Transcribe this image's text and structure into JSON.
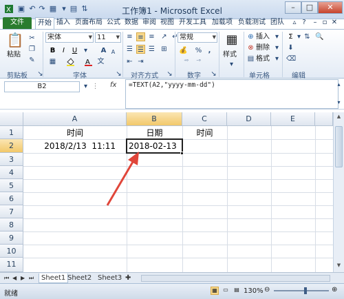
{
  "window": {
    "title": "工作簿1 - Microsoft Excel"
  },
  "tabs": [
    "文件",
    "开始",
    "插入",
    "页面布局",
    "公式",
    "数据",
    "审阅",
    "视图",
    "开发工具",
    "加载项",
    "负载测试",
    "团队"
  ],
  "ribbon": {
    "clipboard": {
      "paste": "粘贴",
      "label": "剪贴板"
    },
    "font": {
      "name": "宋体",
      "size": "11",
      "label": "字体",
      "bold": "B",
      "italic": "I",
      "underline": "U",
      "grow": "A",
      "shrink": "A",
      "wen": "文"
    },
    "alignment": {
      "label": "对齐方式"
    },
    "number": {
      "format": "常规",
      "percent": "%",
      "comma": ",",
      "label": "数字"
    },
    "styles": {
      "label": "样式"
    },
    "cells": {
      "insert": "插入",
      "delete": "删除",
      "format": "格式",
      "label": "单元格"
    },
    "editing": {
      "sigma": "Σ",
      "label": "编辑"
    }
  },
  "formula_bar": {
    "name_box": "B2",
    "fx": "fx",
    "formula": "=TEXT(A2,\"yyyy-mm-dd\")"
  },
  "sheet": {
    "columns": [
      "A",
      "B",
      "C",
      "D",
      "E"
    ],
    "rows": [
      "1",
      "2",
      "3",
      "4",
      "5",
      "6",
      "7",
      "8",
      "9",
      "10",
      "11"
    ],
    "cells": {
      "A1": "时间",
      "B1": "日期",
      "C1": "时间",
      "A2": "2018/2/13  11:11",
      "B2": "2018-02-13"
    }
  },
  "sheet_tabs": [
    "Sheet1",
    "Sheet2",
    "Sheet3"
  ],
  "status_bar": {
    "ready": "就绪",
    "zoom": "130%"
  },
  "colors": {
    "file_tab": "#2a7c2e",
    "annotation_arrow": "#e0463a"
  }
}
